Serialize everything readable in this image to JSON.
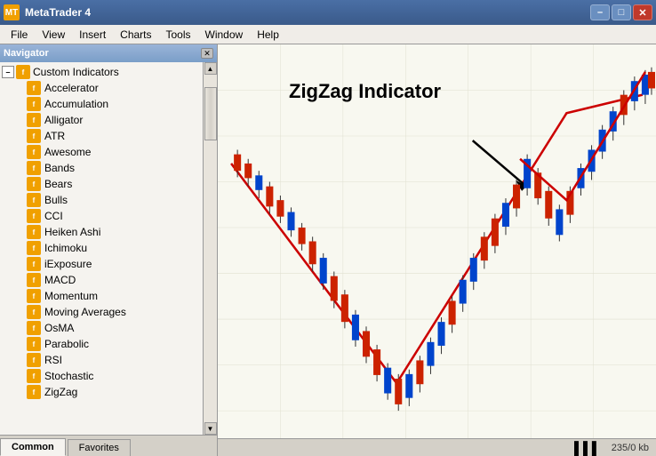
{
  "titleBar": {
    "icon": "MT",
    "title": "MetaTrader 4",
    "minimizeLabel": "–",
    "maximizeLabel": "□",
    "closeLabel": "✕"
  },
  "menuBar": {
    "items": [
      "File",
      "View",
      "Insert",
      "Charts",
      "Tools",
      "Window",
      "Help"
    ]
  },
  "navigator": {
    "title": "Navigator",
    "closeLabel": "✕",
    "rootItem": {
      "expandLabel": "–",
      "iconLabel": "f",
      "label": "Custom Indicators"
    },
    "children": [
      "Accelerator",
      "Accumulation",
      "Alligator",
      "ATR",
      "Awesome",
      "Bands",
      "Bears",
      "Bulls",
      "CCI",
      "Heiken Ashi",
      "Ichimoku",
      "iExposure",
      "MACD",
      "Momentum",
      "Moving Averages",
      "OsMA",
      "Parabolic",
      "RSI",
      "Stochastic",
      "ZigZag"
    ],
    "tabs": [
      "Common",
      "Favorites"
    ]
  },
  "chart": {
    "zigzagLabel": "ZigZag Indicator"
  },
  "statusBar": {
    "icon": "▌▌▌",
    "text": "235/0 kb"
  }
}
